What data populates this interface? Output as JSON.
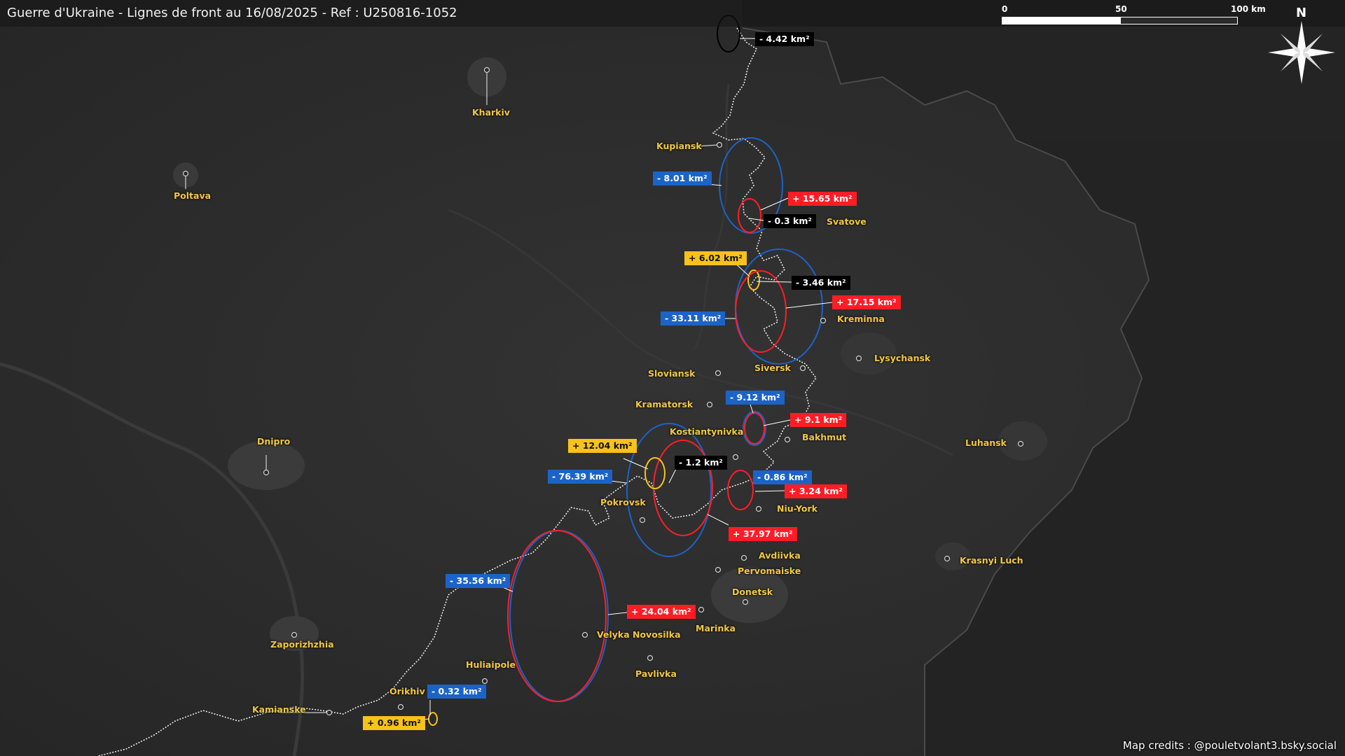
{
  "title": "Guerre d'Ukraine - Lignes de front au 16/08/2025 - Ref : U250816-1052",
  "credits": "Map credits : @pouletvolant3.bsky.social",
  "scale_bar": {
    "labels": [
      "0",
      "50",
      "100 km"
    ]
  },
  "compass": {
    "label": "N"
  },
  "colors": {
    "background": "#2c2c2c",
    "russian_gain": "#ff1d25",
    "ukrainian_gain": "#1c63c8",
    "contested": "#f7c21a",
    "city_label": "#f2c744"
  },
  "cities": {
    "kharkiv": "Kharkiv",
    "poltava": "Poltava",
    "kupiansk": "Kupiansk",
    "svatove": "Svatove",
    "kreminna": "Kreminna",
    "lysychansk": "Lysychansk",
    "siversk": "Siversk",
    "sloviansk": "Sloviansk",
    "kramatorsk": "Kramatorsk",
    "kostiantynivka": "Kostiantynivka",
    "bakhmut": "Bakhmut",
    "luhansk": "Luhansk",
    "dnipro": "Dnipro",
    "pokrovsk": "Pokrovsk",
    "niu_york": "Niu-York",
    "avdiivka": "Avdiivka",
    "pervomaiske": "Pervomaiske",
    "donetsk": "Donetsk",
    "krasnyi_luch": "Krasnyi Luch",
    "zaporizhzhia": "Zaporizhzhia",
    "velyka_novosilka": "Velyka Novosilka",
    "marinka": "Marinka",
    "huliaipole": "Huliaipole",
    "pavlivka": "Pavlivka",
    "orikhiv": "Orikhiv",
    "kamianske": "Kamianske"
  },
  "changes": {
    "c1": "- 4.42 km²",
    "c2": "- 8.01 km²",
    "c3": "+ 15.65 km²",
    "c4": "- 0.3 km²",
    "c5": "+ 6.02 km²",
    "c6": "- 3.46 km²",
    "c7": "+ 17.15 km²",
    "c8": "- 33.11 km²",
    "c9": "- 9.12 km²",
    "c10": "+ 9.1 km²",
    "c11": "+ 12.04 km²",
    "c12": "- 1.2 km²",
    "c13": "- 76.39 km²",
    "c14": "- 0.86 km²",
    "c15": "+ 3.24 km²",
    "c16": "+ 37.97 km²",
    "c17": "- 35.56 km²",
    "c18": "+ 24.04 km²",
    "c19": "- 0.32 km²",
    "c20": "+ 0.96 km²"
  }
}
